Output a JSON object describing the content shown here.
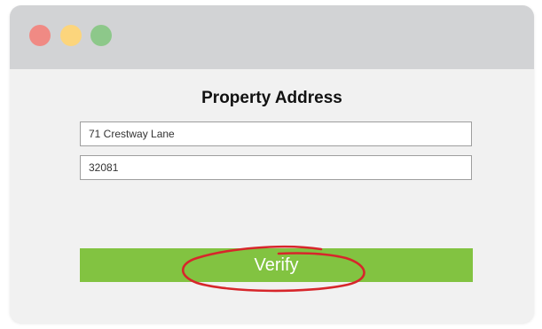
{
  "window": {
    "controls": [
      "close",
      "minimize",
      "maximize"
    ]
  },
  "form": {
    "title": "Property Address",
    "street_value": "71 Crestway Lane",
    "zip_value": "32081",
    "verify_label": "Verify"
  },
  "colors": {
    "titlebar": "#d2d3d5",
    "window_bg": "#f1f1f1",
    "close": "#f08a84",
    "minimize": "#fcd57c",
    "maximize": "#8dc88a",
    "button": "#82c341",
    "annotation": "#d7262b"
  },
  "annotation": {
    "type": "hand-drawn-ellipse",
    "target": "verify-button"
  }
}
